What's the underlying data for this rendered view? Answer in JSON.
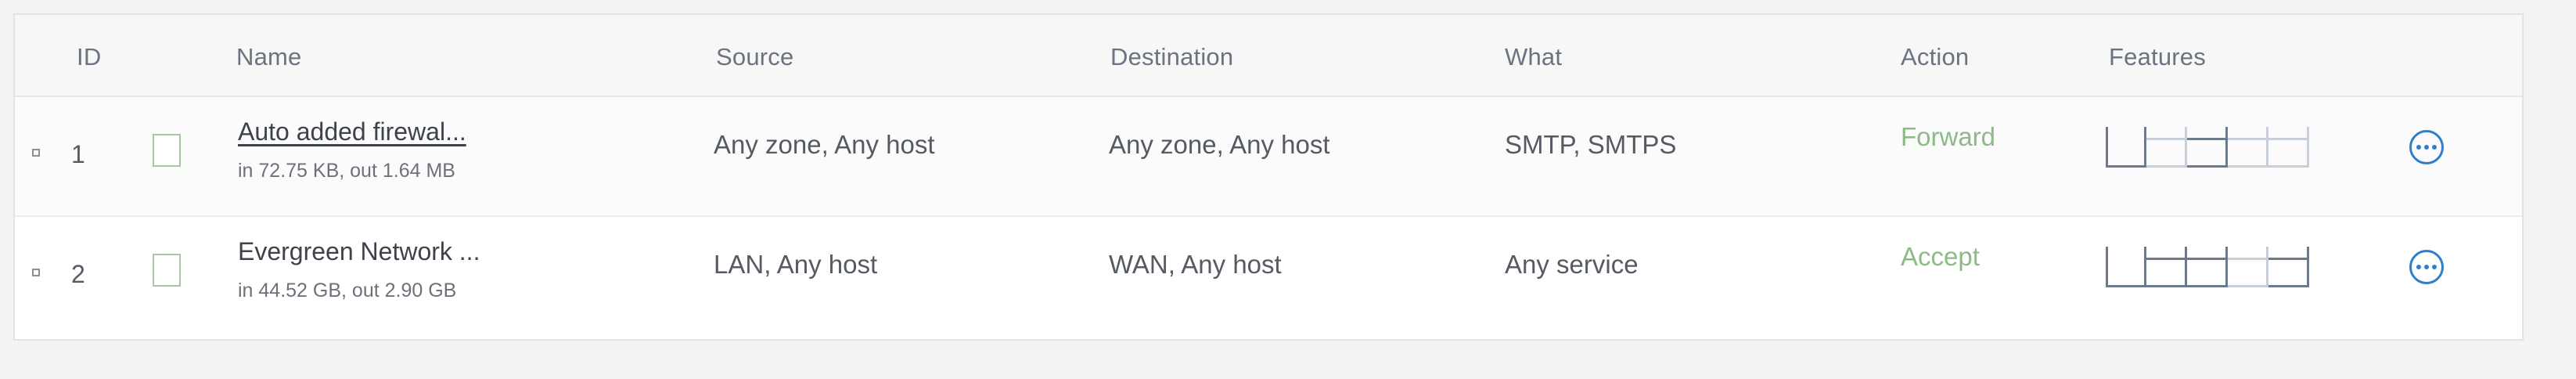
{
  "table": {
    "headers": {
      "id": "ID",
      "name": "Name",
      "source": "Source",
      "destination": "Destination",
      "what": "What",
      "action": "Action",
      "features": "Features"
    },
    "rows": [
      {
        "id": "1",
        "name": "Auto added firewal...",
        "traffic": "in 72.75 KB, out 1.64 MB",
        "source": "Any zone, Any host",
        "destination": "Any zone, Any host",
        "what": "SMTP, SMTPS",
        "action": "Forward"
      },
      {
        "id": "2",
        "name": "Evergreen Network ...",
        "traffic": "in 44.52 GB, out 2.90 GB",
        "source": "LAN, Any host",
        "destination": "WAN, Any host",
        "what": "Any service",
        "action": "Accept"
      }
    ]
  },
  "colors": {
    "action_text": "#8dbb86",
    "more_icon": "#2f7fc8",
    "checkbox_border": "#a6c7a2"
  },
  "icons": {
    "drag": "drag-handle-icon",
    "checkbox": "checkbox-icon",
    "features": "feature-indicator-icon",
    "more": "more-options-icon"
  }
}
